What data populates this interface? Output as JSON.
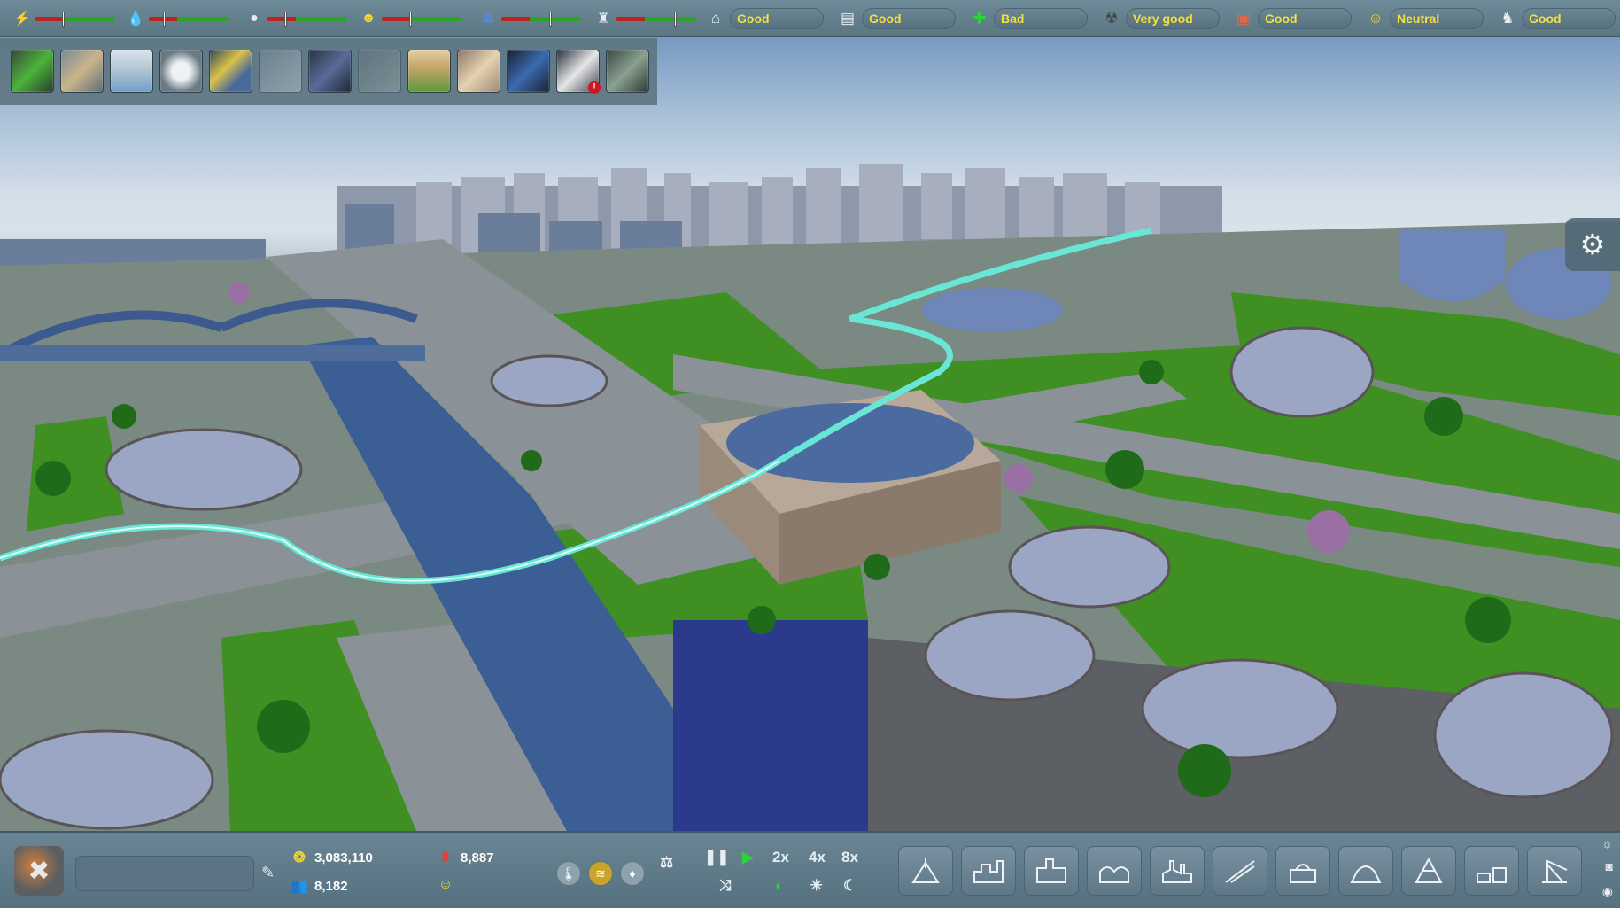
{
  "status_meters": [
    {
      "name": "power",
      "icon": "lightning-icon",
      "level": 0.35
    },
    {
      "name": "water",
      "icon": "water-drop-icon",
      "level": 0.18
    },
    {
      "name": "waste",
      "icon": "trash-bag-icon",
      "level": 0.22
    },
    {
      "name": "workers",
      "icon": "worker-icon",
      "level": 0.36
    },
    {
      "name": "police",
      "icon": "police-icon",
      "level": 0.62
    },
    {
      "name": "fire",
      "icon": "fire-icon",
      "level": 0.75
    }
  ],
  "ratings": [
    {
      "icon": "housing-icon",
      "label": "Good"
    },
    {
      "icon": "education-icon",
      "label": "Good"
    },
    {
      "icon": "health-cross-icon",
      "label": "Bad"
    },
    {
      "icon": "environment-icon",
      "label": "Very good"
    },
    {
      "icon": "safety-icon",
      "label": "Good"
    },
    {
      "icon": "culture-icon",
      "label": "Neutral"
    },
    {
      "icon": "leisure-icon",
      "label": "Good"
    }
  ],
  "tools": [
    {
      "icon": "terraform-icon",
      "dim": false
    },
    {
      "icon": "zoning-icon",
      "dim": false
    },
    {
      "icon": "statistics-icon",
      "dim": false
    },
    {
      "icon": "info-icon",
      "dim": false
    },
    {
      "icon": "services-icon",
      "dim": false
    },
    {
      "icon": "research-icon",
      "dim": true
    },
    {
      "icon": "transport-icon",
      "dim": false
    },
    {
      "icon": "park-icon",
      "dim": true
    },
    {
      "icon": "landscape-icon",
      "dim": false
    },
    {
      "icon": "policy-icon",
      "dim": false
    },
    {
      "icon": "traffic-icon",
      "dim": false
    },
    {
      "icon": "messages-icon",
      "dim": false,
      "badge": "!"
    },
    {
      "icon": "library-icon",
      "dim": false
    }
  ],
  "bottom": {
    "money": "3,083,110",
    "population": "8,182",
    "growth": "8,887",
    "speed_labels": {
      "two": "2x",
      "four": "4x",
      "eight": "8x"
    }
  },
  "build_categories": [
    {
      "icon": "energy-build-icon"
    },
    {
      "icon": "residential-build-icon"
    },
    {
      "icon": "industrial-build-icon"
    },
    {
      "icon": "commercial-build-icon"
    },
    {
      "icon": "factory-build-icon"
    },
    {
      "icon": "road-build-icon"
    },
    {
      "icon": "services-build-icon"
    },
    {
      "icon": "landmark-build-icon"
    },
    {
      "icon": "dome-build-icon"
    },
    {
      "icon": "storage-build-icon"
    },
    {
      "icon": "crane-build-icon"
    }
  ],
  "colors": {
    "rating_text": "#f2e13a",
    "active_play": "#2fd13d",
    "alert": "#d3161c"
  }
}
